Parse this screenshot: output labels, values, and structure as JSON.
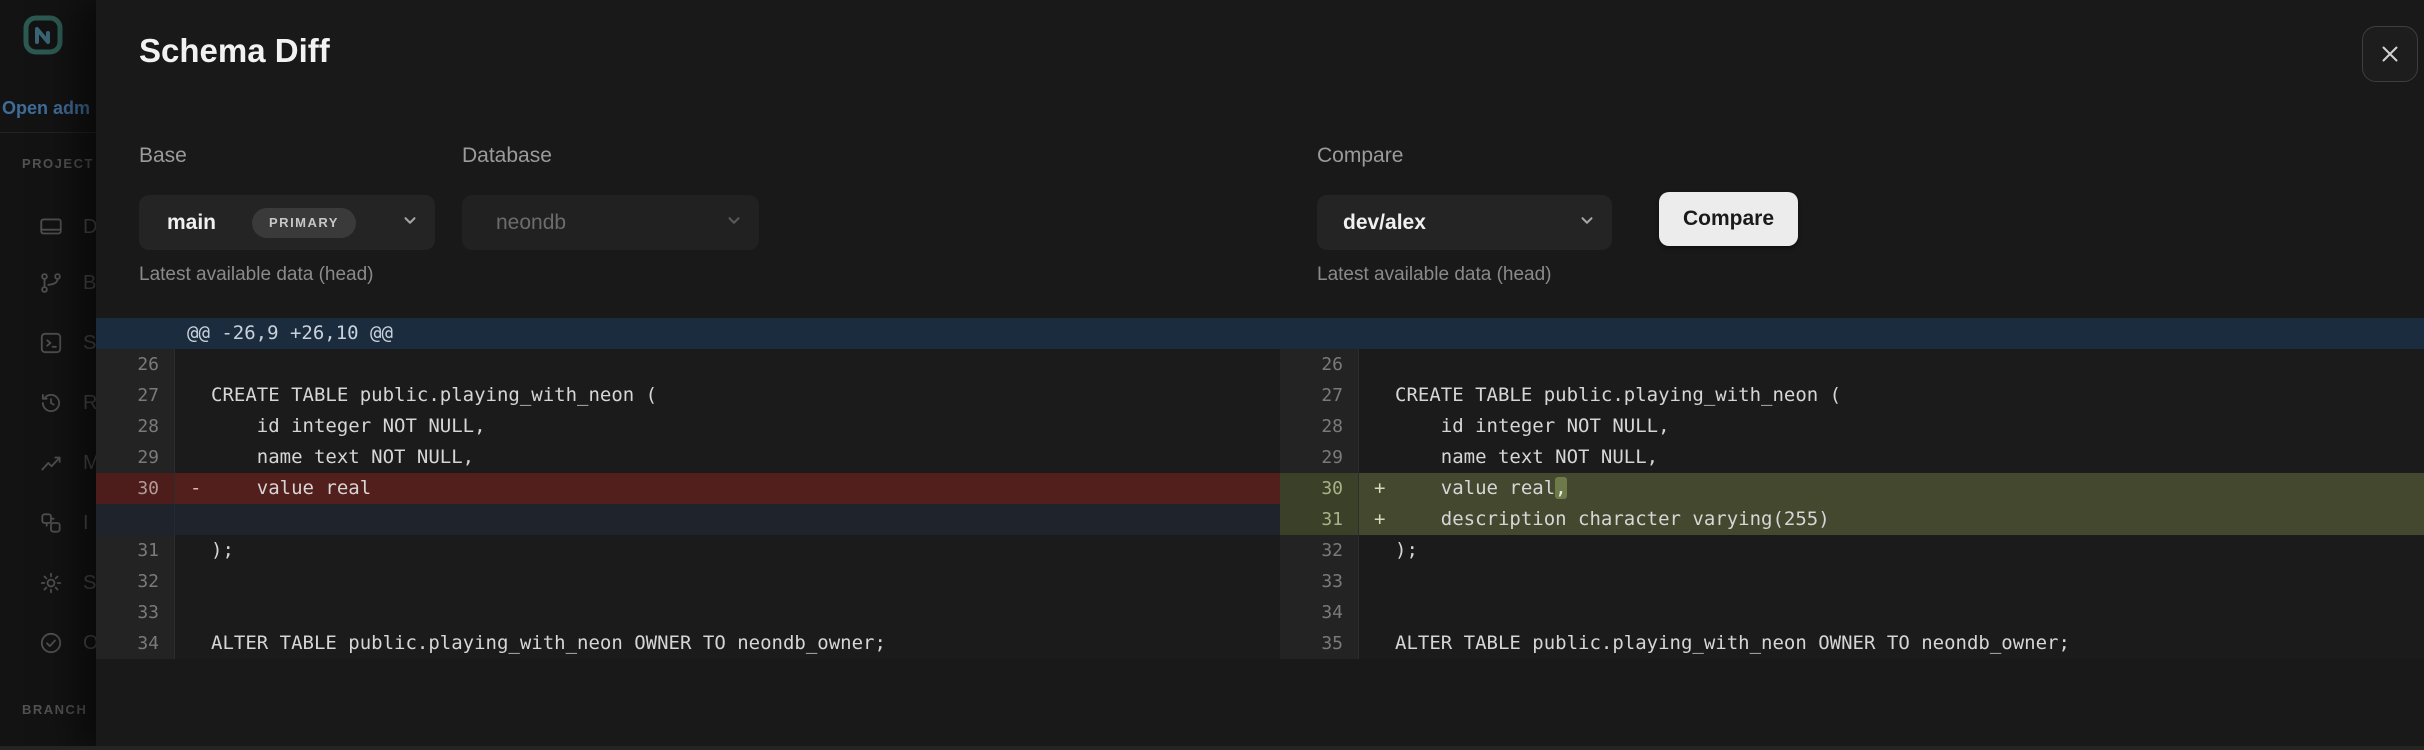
{
  "sidebar": {
    "open_admin_label": "Open adm",
    "sections": {
      "project": "PROJECT",
      "branch": "BRANCH"
    },
    "items": [
      {
        "icon": "dashboard-icon",
        "visible_label": "D"
      },
      {
        "icon": "branches-icon",
        "visible_label": "B"
      },
      {
        "icon": "sql-editor-icon",
        "visible_label": "S"
      },
      {
        "icon": "restore-icon",
        "visible_label": "R"
      },
      {
        "icon": "monitoring-icon",
        "visible_label": "M"
      },
      {
        "icon": "integrations-icon",
        "visible_label": "I"
      },
      {
        "icon": "settings-icon",
        "visible_label": "S"
      },
      {
        "icon": "operations-icon",
        "visible_label": "O"
      }
    ]
  },
  "modal": {
    "title": "Schema Diff",
    "close_icon": "✕",
    "base": {
      "label": "Base",
      "value": "main",
      "badge": "PRIMARY",
      "helper": "Latest available data (head)"
    },
    "database": {
      "label": "Database",
      "value": "neondb"
    },
    "compare": {
      "label": "Compare",
      "value": "dev/alex",
      "button_label": "Compare",
      "helper": "Latest available data (head)"
    }
  },
  "diff": {
    "hunk_header": "@@ -26,9 +26,10 @@",
    "left": {
      "rows": [
        {
          "num": "26",
          "marker": "",
          "type": "context",
          "segments": [
            {
              "text": ""
            }
          ]
        },
        {
          "num": "27",
          "marker": "",
          "type": "context",
          "segments": [
            {
              "text": "CREATE TABLE public.playing_with_neon ("
            }
          ]
        },
        {
          "num": "28",
          "marker": "",
          "type": "context",
          "segments": [
            {
              "text": "    id integer NOT NULL,"
            }
          ]
        },
        {
          "num": "29",
          "marker": "",
          "type": "context",
          "segments": [
            {
              "text": "    name text NOT NULL,"
            }
          ]
        },
        {
          "num": "30",
          "marker": "-",
          "type": "removed",
          "segments": [
            {
              "text": "    value real"
            }
          ]
        },
        {
          "num": "",
          "marker": "",
          "type": "filler",
          "segments": [
            {
              "text": ""
            }
          ]
        },
        {
          "num": "31",
          "marker": "",
          "type": "context",
          "segments": [
            {
              "text": ");"
            }
          ]
        },
        {
          "num": "32",
          "marker": "",
          "type": "context",
          "segments": [
            {
              "text": ""
            }
          ]
        },
        {
          "num": "33",
          "marker": "",
          "type": "context",
          "segments": [
            {
              "text": ""
            }
          ]
        },
        {
          "num": "34",
          "marker": "",
          "type": "context",
          "segments": [
            {
              "text": "ALTER TABLE public.playing_with_neon OWNER TO neondb_owner;"
            }
          ]
        }
      ]
    },
    "right": {
      "rows": [
        {
          "num": "26",
          "marker": "",
          "type": "context",
          "segments": [
            {
              "text": ""
            }
          ]
        },
        {
          "num": "27",
          "marker": "",
          "type": "context",
          "segments": [
            {
              "text": "CREATE TABLE public.playing_with_neon ("
            }
          ]
        },
        {
          "num": "28",
          "marker": "",
          "type": "context",
          "segments": [
            {
              "text": "    id integer NOT NULL,"
            }
          ]
        },
        {
          "num": "29",
          "marker": "",
          "type": "context",
          "segments": [
            {
              "text": "    name text NOT NULL,"
            }
          ]
        },
        {
          "num": "30",
          "marker": "+",
          "type": "added",
          "segments": [
            {
              "text": "    value real"
            },
            {
              "text": ",",
              "highlight": true
            }
          ]
        },
        {
          "num": "31",
          "marker": "+",
          "type": "added",
          "segments": [
            {
              "text": "    description character varying(255)"
            }
          ]
        },
        {
          "num": "32",
          "marker": "",
          "type": "context",
          "segments": [
            {
              "text": ");"
            }
          ]
        },
        {
          "num": "33",
          "marker": "",
          "type": "context",
          "segments": [
            {
              "text": ""
            }
          ]
        },
        {
          "num": "34",
          "marker": "",
          "type": "context",
          "segments": [
            {
              "text": ""
            }
          ]
        },
        {
          "num": "35",
          "marker": "",
          "type": "context",
          "segments": [
            {
              "text": "ALTER TABLE public.playing_with_neon OWNER TO neondb_owner;"
            }
          ]
        }
      ]
    }
  },
  "colors": {
    "modal_bg": "#191919",
    "removed_row_bg": "#531f1c",
    "added_row_bg": "#44482f",
    "added_word_highlight_bg": "#6f7a4b",
    "filler_row_bg": "#1f242c",
    "hunk_header_bg": "#1b2c3e",
    "primary_button_bg": "#ececec",
    "code_text": "#d6d6d6"
  }
}
